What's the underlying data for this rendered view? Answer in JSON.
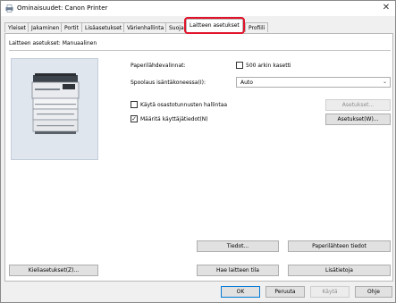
{
  "window": {
    "title": "Ominaisuudet: Canon Printer"
  },
  "tabs": [
    {
      "label": "Yleiset"
    },
    {
      "label": "Jakaminen"
    },
    {
      "label": "Portit"
    },
    {
      "label": "Lisäasetukset"
    },
    {
      "label": "Värienhallinta"
    },
    {
      "label": "Suojaus"
    },
    {
      "label": "Laitteen asetukset"
    },
    {
      "label": "Profiili"
    }
  ],
  "active_tab": "Laitteen asetukset",
  "highlight_color": "#e1132a",
  "panel": {
    "section_title": "Laitteen asetukset: Manuaalinen",
    "paper_source_label": "Paperilähdevalinnat:",
    "paper_source_checkbox": "500 arkin kasetti",
    "spool_label": "Spoolaus isäntäkoneessa(I):",
    "spool_value": "Auto",
    "dept_id_label": "Käytä osastotunnusten hallintaa",
    "dept_id_settings_button": "Asetukset...",
    "user_info_label": "Määritä käyttäjätiedot(N)",
    "user_info_checked": true,
    "user_info_settings_button": "Asetukset(W)...",
    "details_button": "Tiedot...",
    "paper_source_info_button": "Paperilähteen tiedot",
    "language_settings_button": "Kieliasetukset(Z)...",
    "get_device_status_button": "Hae laitteen tila",
    "about_button": "Lisätietoja"
  },
  "footer": {
    "ok": "OK",
    "cancel": "Peruuta",
    "apply": "Käytä",
    "help": "Ohje"
  }
}
